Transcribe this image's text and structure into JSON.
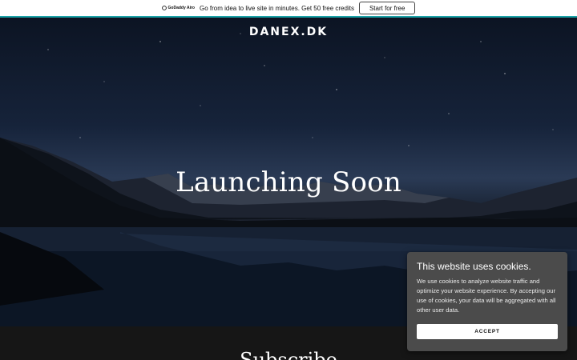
{
  "promo": {
    "logo_text": "GoDaddy Airo",
    "text": "Go from idea to live site in minutes. Get 50 free credits",
    "button": "Start for free"
  },
  "site": {
    "title": "DANEX.DK",
    "headline": "Launching Soon"
  },
  "subscribe": {
    "title": "Subscribe"
  },
  "cookie": {
    "title": "This website uses cookies.",
    "body": "We use cookies to analyze website traffic and optimize your website experience. By accepting our use of cookies, your data will be aggregated with all other user data.",
    "button": "ACCEPT"
  },
  "colors": {
    "accent_bar": "#1aa3a8",
    "cookie_bg": "#4b4b4b",
    "dark_bg": "#161616"
  }
}
